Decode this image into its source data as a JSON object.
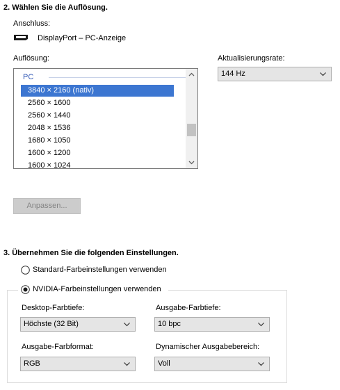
{
  "section2": {
    "heading": "2. Wählen Sie die Auflösung.",
    "connection_label": "Anschluss:",
    "connection_value": "DisplayPort – PC-Anzeige",
    "connection_icon": "displayport-icon",
    "resolution_label": "Auflösung:",
    "resolution_group": "PC",
    "resolutions": [
      "3840 × 2160 (nativ)",
      "2560 × 1600",
      "2560 × 1440",
      "2048 × 1536",
      "1680 × 1050",
      "1600 × 1200",
      "1600 × 1024"
    ],
    "selected_resolution": "3840 × 2160 (nativ)",
    "refresh_label": "Aktualisierungsrate:",
    "refresh_value": "144 Hz",
    "customize_button": "Anpassen..."
  },
  "section3": {
    "heading": "3. Übernehmen Sie die folgenden Einstellungen.",
    "radio_standard": "Standard-Farbeinstellungen verwenden",
    "radio_nvidia": "NVIDIA-Farbeinstellungen verwenden",
    "selected_radio": "nvidia",
    "desktop_depth_label": "Desktop-Farbtiefe:",
    "desktop_depth_value": "Höchste (32 Bit)",
    "output_depth_label": "Ausgabe-Farbtiefe:",
    "output_depth_value": "10 bpc",
    "output_format_label": "Ausgabe-Farbformat:",
    "output_format_value": "RGB",
    "dynamic_range_label": "Dynamischer Ausgabebereich:",
    "dynamic_range_value": "Voll"
  },
  "colors": {
    "selection": "#3c76d1",
    "group_text": "#2f57b5",
    "disabled_button": "#cccccc"
  }
}
